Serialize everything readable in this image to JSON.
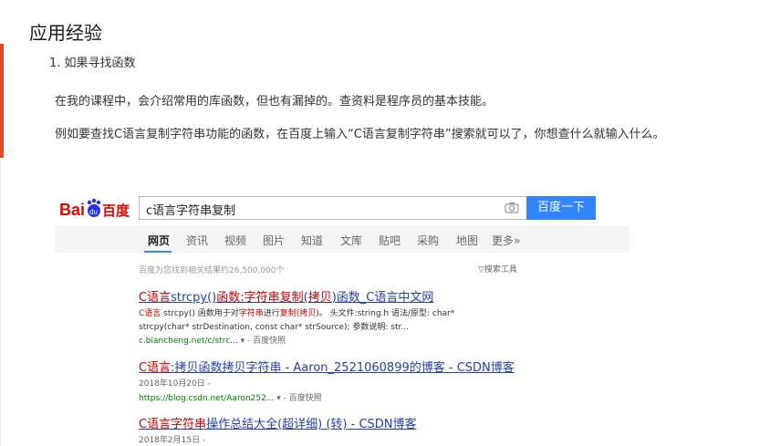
{
  "article": {
    "heading": "应用经验",
    "list_item": "1. 如果寻找函数",
    "para1": "在我的课程中，会介绍常用的库函数，但也有漏掉的。查资料是程序员的基本技能。",
    "para2": "例如要查找C语言复制字符串功能的函数，在百度上输入“C语言复制字符串”搜索就可以了，你想查什么就输入什么。"
  },
  "baidu": {
    "logo": "Bai百度",
    "query": "c语言字符串复制",
    "search_button": "百度一下",
    "tabs": [
      "网页",
      "资讯",
      "视频",
      "图片",
      "知道",
      "文库",
      "贴吧",
      "采购",
      "地图",
      "更多»"
    ],
    "result_count": "百度为您找到相关结果约26,500,000个",
    "tools": "▽搜索工具",
    "results": [
      {
        "title_hl1": "C语言",
        "title_mid1": "strcpy()",
        "title_hl2": "函数:字符串复制",
        "title_mid2": "(",
        "title_hl3": "拷贝",
        "title_mid3": ")函数_C语言中文网",
        "abs1_hl": "C语言",
        "abs1_rest_a": " strcpy() 函数用于对",
        "abs1_hl2": "字符串",
        "abs1_rest_b": "进行",
        "abs1_hl3": "复制(拷贝)",
        "abs1_rest_c": "。 头文件:string.h 语法/原型: char*",
        "abs2": "strcpy(char* strDestination, const char* strSource); 参数说明: str...",
        "url": "c.biancheng.net/c/strc...",
        "snapshot": " ▾ - 百度快照"
      },
      {
        "title_hl1": "C语言",
        "title_rest": ":拷贝函数拷贝字符串 - Aaron_2521060899的博客 - CSDN博客",
        "date": "2018年10月20日 -",
        "url": "https://blog.csdn.net/Aaron252...",
        "snapshot": " ▾ - 百度快照"
      },
      {
        "title_hl1": "C语言字符串",
        "title_rest": "操作总结大全(超详细) (转) - CSDN博客",
        "date": "2018年2月15日 -"
      }
    ]
  },
  "colors": {
    "accent_edge": "#e04a2f",
    "baidu_blue": "#3385ff",
    "baidu_red": "#e10601",
    "link_blue": "#2440b3",
    "highlight_red": "#cc0000",
    "url_green": "#008000"
  },
  "icons": [
    "camera-icon",
    "baidu-paw-icon"
  ]
}
